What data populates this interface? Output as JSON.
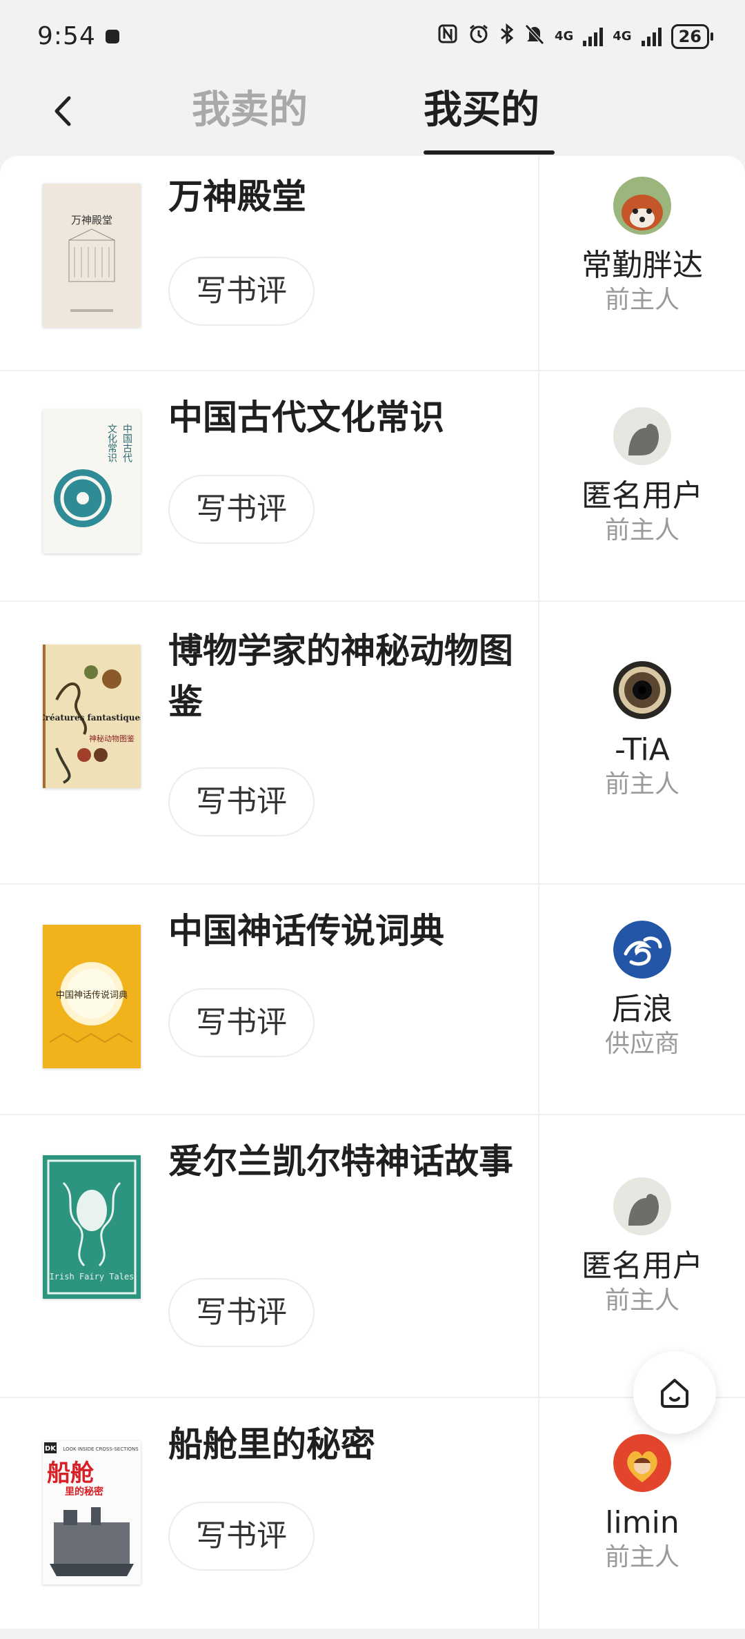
{
  "status_bar": {
    "time": "9:54",
    "network_1": "4G",
    "network_2": "4G",
    "battery": "26"
  },
  "tabs": {
    "sell": "我卖的",
    "buy": "我买的"
  },
  "review_label": "写书评",
  "items": [
    {
      "title": "万神殿堂",
      "seller": "常勤胖达",
      "role": "前主人"
    },
    {
      "title": "中国古代文化常识",
      "seller": "匿名用户",
      "role": "前主人"
    },
    {
      "title": "博物学家的神秘动物图鉴",
      "seller": "-TiA",
      "role": "前主人"
    },
    {
      "title": "中国神话传说词典",
      "seller": "后浪",
      "role": "供应商"
    },
    {
      "title": "爱尔兰凯尔特神话故事",
      "seller": "匿名用户",
      "role": "前主人"
    },
    {
      "title": "船舱里的秘密",
      "seller": "limin",
      "role": "前主人"
    }
  ],
  "covers": {
    "c1": {
      "title": "万神殿堂"
    },
    "c2": {
      "title_a": "中国古代",
      "title_b": "文化常识"
    },
    "c3": {
      "title": "Créatures fantastiques",
      "sub": "神秘动物图鉴"
    },
    "c4": {
      "title": "中国神话传说词典"
    },
    "c5": {
      "title": "Irish Fairy Tales"
    },
    "c6": {
      "brand": "DK",
      "title": "船舱",
      "sub": "里的秘密",
      "tag": "LOOK INSIDE CROSS-SECTIONS"
    }
  },
  "icons": {
    "back": "chevron-left-icon",
    "home": "home-icon",
    "bluetooth": "bluetooth-icon",
    "alarm": "alarm-icon",
    "nfc": "nfc-icon",
    "mute": "bell-muted-icon"
  }
}
